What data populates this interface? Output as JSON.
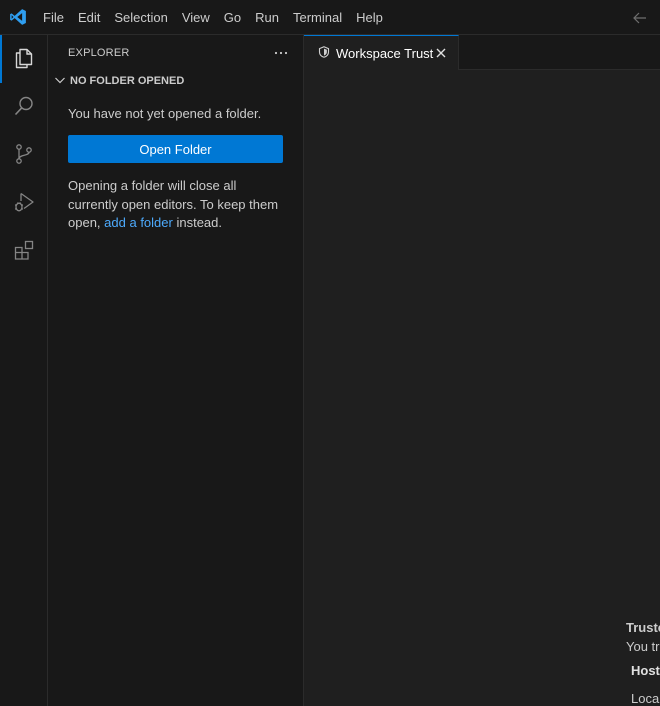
{
  "menubar": {
    "items": [
      "File",
      "Edit",
      "Selection",
      "View",
      "Go",
      "Run",
      "Terminal",
      "Help"
    ]
  },
  "activitybar": {
    "items": [
      {
        "name": "explorer",
        "icon": "files-icon",
        "active": true
      },
      {
        "name": "search",
        "icon": "search-icon"
      },
      {
        "name": "source-control",
        "icon": "source-control-icon"
      },
      {
        "name": "run-and-debug",
        "icon": "run-debug-icon"
      },
      {
        "name": "extensions",
        "icon": "extensions-icon"
      }
    ]
  },
  "sidebar": {
    "title": "EXPLORER",
    "section_title": "NO FOLDER OPENED",
    "welcome_message": "You have not yet opened a folder.",
    "open_folder_label": "Open Folder",
    "note_prefix": "Opening a folder will close all currently open editors. To keep them open,",
    "note_link": "add a folder",
    "note_suffix": "instead."
  },
  "editor": {
    "tab_label": "Workspace Trust",
    "trust_title": "Truste",
    "trust_desc": "You tr",
    "host_label": "Host",
    "local_label": "Local"
  },
  "colors": {
    "accent": "#0078d4",
    "link": "#4daafc",
    "background": "#1f1f1f",
    "sidebar_bg": "#181818"
  }
}
